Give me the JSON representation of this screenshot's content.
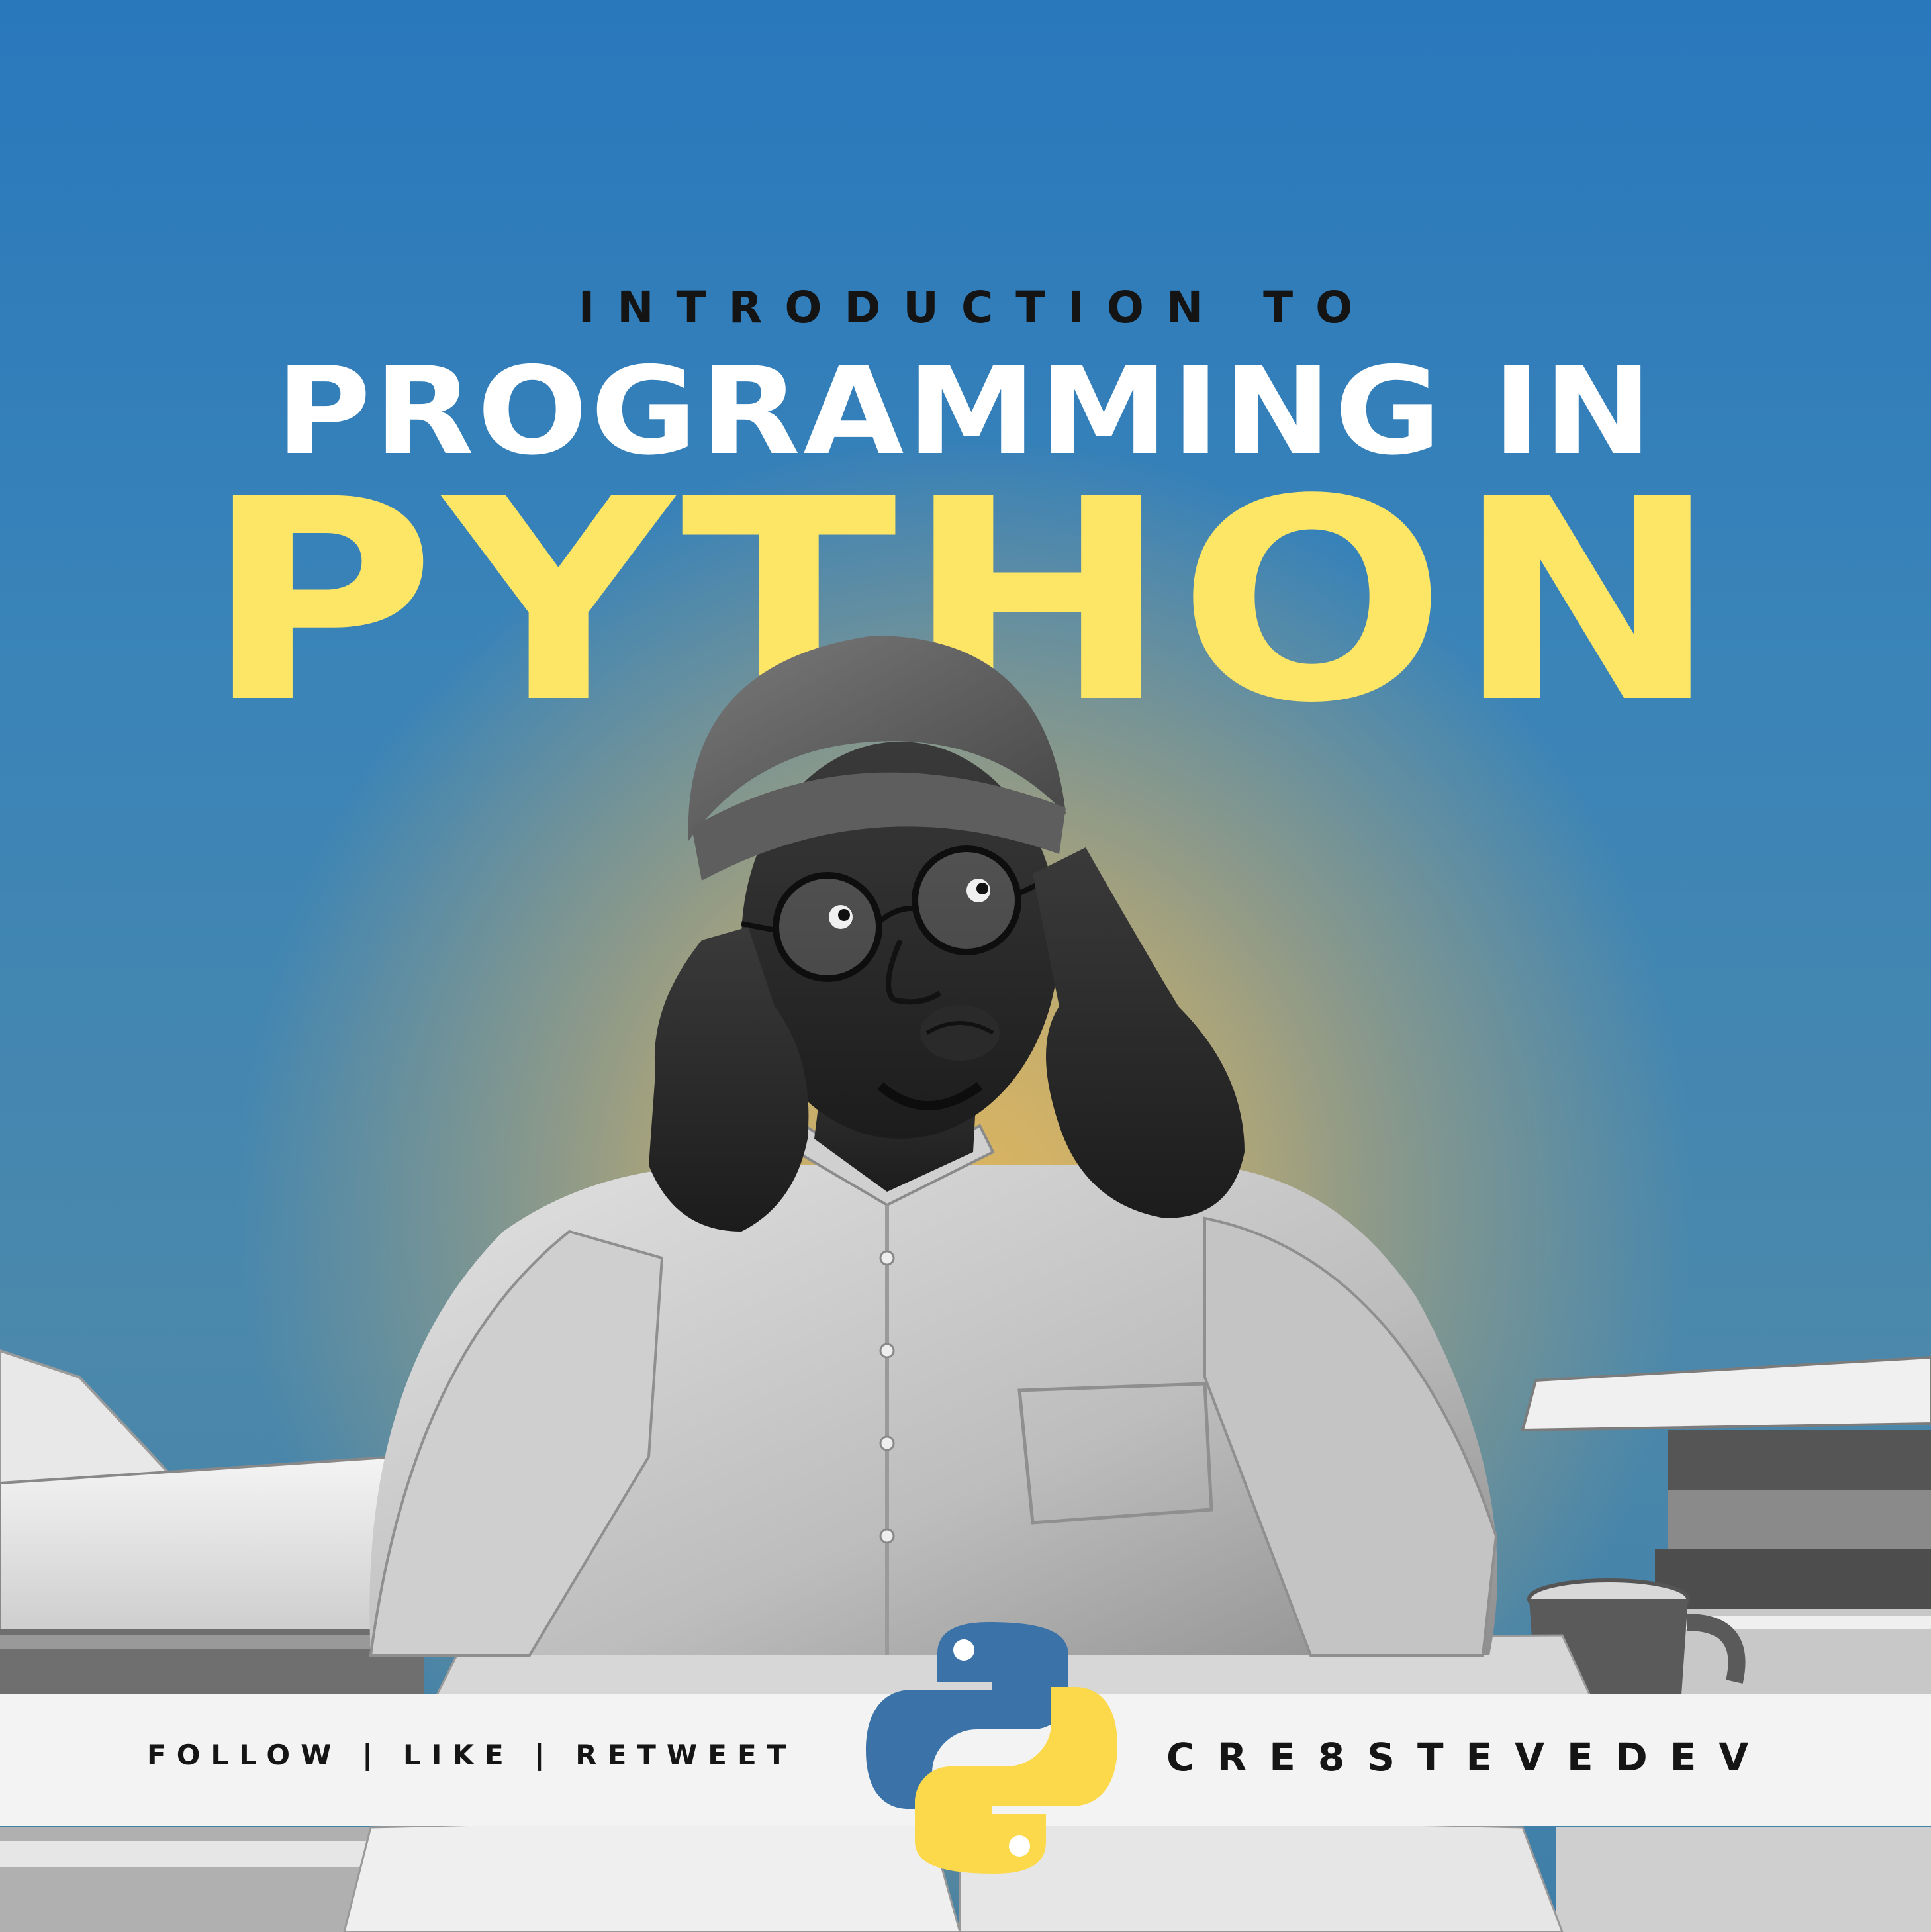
{
  "poster": {
    "kicker": "INTRODUCTION TO",
    "headline": "PROGRAMMING IN",
    "language": "PYTHON"
  },
  "banner": {
    "call_to_action": "FOLLOW | LIKE | RETWEET",
    "handle": "CRE8STEVEDEV"
  },
  "colors": {
    "background_top": "#2a78bc",
    "glow": "#dcb560",
    "headline": "#ffffff",
    "language": "#fde566",
    "kicker": "#141414",
    "banner": "#f3f3f3",
    "python_blue": "#3b73a8",
    "python_yellow": "#fcd94a"
  },
  "icons": {
    "logo": "python-logo-icon"
  }
}
